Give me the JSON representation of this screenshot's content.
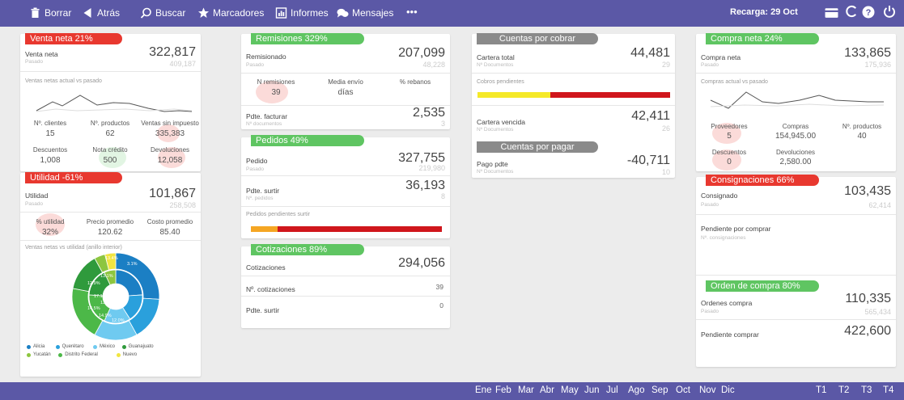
{
  "toolbar": {
    "borrar": "Borrar",
    "atras": "Atrás",
    "buscar": "Buscar",
    "marcadores": "Marcadores",
    "informes": "Informes",
    "mensajes": "Mensajes",
    "more": "•••",
    "recarga": "Recarga: 29 Oct"
  },
  "colors": {
    "brand": "#5b58a6",
    "red": "#e8382f",
    "green": "#5fc562",
    "yellow": "#f5e928"
  },
  "venta": {
    "tag": "Venta neta   21%",
    "label": "Venta neta",
    "pasado_label": "Pasado",
    "value": "322,817",
    "pasado": "409,187",
    "chart_title": "Ventas netas actual vs pasado",
    "m1h": "Nº. clientes",
    "m1v": "15",
    "m2h": "Nº. productos",
    "m2v": "62",
    "m3h": "Ventas sin impuesto",
    "m3v": "335,383",
    "m4h": "Descuentos",
    "m4v": "1,008",
    "m5h": "Nota crédito",
    "m5v": "500",
    "m6h": "Devoluciones",
    "m6v": "12,058"
  },
  "utilidad": {
    "tag": "Utilidad  -61%",
    "label": "Utilidad",
    "pasado_label": "Pasado",
    "value": "101,867",
    "pasado": "258,508",
    "m1h": "% utilidad",
    "m1v": "32%",
    "m2h": "Precio promedio",
    "m2v": "120.62",
    "m3h": "Costo promedio",
    "m3v": "85.40",
    "chart_title": "Ventas netas vs utilidad (anillo interior)",
    "legend": [
      "Alicia",
      "Querétaro",
      "México",
      "Guanajuato",
      "Yucatán",
      "Distrito Federal",
      "Nuevo"
    ],
    "legend_colors": [
      "#1b7fc4",
      "#2aa0dc",
      "#6fcaf0",
      "#2f9a3c",
      "#8dc63f",
      "#4cb848",
      "#f1e540"
    ]
  },
  "remisiones": {
    "tag": "Remisiones   329%",
    "label": "Remisionado",
    "pasado_label": "Pasado",
    "value": "207,099",
    "pasado": "48,228",
    "m1h": "N remisiones",
    "m1v": "39",
    "m2h": "Media envío",
    "m2v": "días",
    "m3h": "% rebanos",
    "facturar_label": "Pdte. facturar",
    "facturar_sub": "Nº documentos",
    "facturar_value": "2,535",
    "facturar_small": "3"
  },
  "pedidos": {
    "tag": "Pedidos   49%",
    "label": "Pedido",
    "pasado_label": "Pasado",
    "value": "327,755",
    "pasado": "219,980",
    "surtir_label": "Pdte. surtir",
    "surtir_sub": "Nº. pedidos",
    "surtir_value": "36,193",
    "surtir_small": "8",
    "bar_label": "Pedidos pendientes surtir"
  },
  "cotizaciones": {
    "tag": "Cotizaciones   89%",
    "c1": "Cotizaciones",
    "c1v": "294,056",
    "c2": "Nº. cotizaciones",
    "c2v": "39",
    "c3": "Pdte. surtir",
    "c3v": "0"
  },
  "cobrar": {
    "tag": "Cuentas por cobrar",
    "label": "Cartera total",
    "sub": "Nº Documentos",
    "value": "44,481",
    "small": "29",
    "cobros": "Cobros pendientes",
    "vencida": "Cartera vencida",
    "vencida_sub": "Nº Documentos",
    "vencida_value": "42,411",
    "vencida_small": "26"
  },
  "pagar": {
    "tag": "Cuentas por pagar",
    "label": "Pago pdte",
    "sub": "Nº Documentos",
    "value": "-40,711",
    "small": "10"
  },
  "compra": {
    "tag": "Compra neta   24%",
    "label": "Compra neta",
    "pasado_label": "Pasado",
    "value": "133,865",
    "pasado": "175,936",
    "chart_title": "Compras actual vs pasado",
    "m1h": "Proveedores",
    "m1v": "5",
    "m2h": "Compras",
    "m2v": "154,945.00",
    "m3h": "Nº. productos",
    "m3v": "40",
    "m4h": "Descuentos",
    "m4v": "0",
    "m5h": "Devoluciones",
    "m5v": "2,580.00"
  },
  "consignaciones": {
    "tag": "Consignaciones   66%",
    "label": "Consignado",
    "pasado_label": "Pasado",
    "value": "103,435",
    "pasado": "62,414",
    "pend": "Pendiente por comprar",
    "pend_sub": "Nº. consignaciones"
  },
  "orden": {
    "tag": "Orden de compra   80%",
    "label": "Ordenes compra",
    "pasado_label": "Pasado",
    "value": "110,335",
    "pasado": "565,434",
    "pend": "Pendiente comprar",
    "pend_value": "422,600"
  },
  "months": [
    "Ene",
    "Feb",
    "Mar",
    "Abr",
    "May",
    "Jun",
    "Jul",
    "Ago",
    "Sep",
    "Oct",
    "Nov",
    "Dic"
  ],
  "quarters": [
    "T1",
    "T2",
    "T3",
    "T4"
  ],
  "donut_labels": [
    "13.4%",
    "3.1%",
    "12.9%",
    "13.1%",
    "17.1%",
    "3.6%",
    "14.5%",
    "13.6%",
    "14.9%",
    "12.0%"
  ]
}
